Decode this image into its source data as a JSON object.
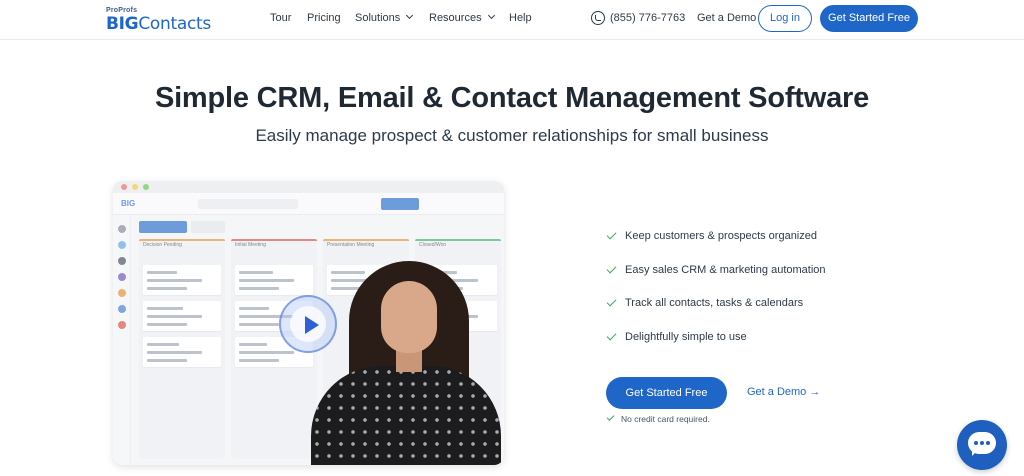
{
  "brand": {
    "top": "ProProfs",
    "main_bold": "BIG",
    "main_rest": "Contacts"
  },
  "nav": {
    "links": [
      {
        "label": "Tour",
        "dropdown": false
      },
      {
        "label": "Pricing",
        "dropdown": false
      },
      {
        "label": "Solutions",
        "dropdown": true
      },
      {
        "label": "Resources",
        "dropdown": true
      },
      {
        "label": "Help",
        "dropdown": false
      }
    ],
    "phone": "(855) 776-7763",
    "demo": "Get a Demo",
    "login": "Log in",
    "cta": "Get Started Free"
  },
  "hero": {
    "title": "Simple CRM, Email & Contact Management Software",
    "subtitle": "Easily manage prospect & customer relationships for small business",
    "features": [
      "Keep customers & prospects organized",
      "Easy sales CRM & marketing automation",
      "Track all contacts, tasks & calendars",
      "Delightfully simple to use"
    ],
    "cta": "Get Started Free",
    "demo": "Get a Demo →",
    "note": "No credit card required."
  },
  "video": {
    "columns": [
      "Decision Pending",
      "Initial Meeting",
      "Presentation Meeting",
      "Closed/Won"
    ]
  },
  "colors": {
    "accent": "#1f66c9",
    "check": "#3caa5a",
    "text": "#1f2933"
  },
  "icons": [
    "phone-icon",
    "chevron-down-icon",
    "check-icon",
    "play-icon",
    "chat-icon"
  ]
}
